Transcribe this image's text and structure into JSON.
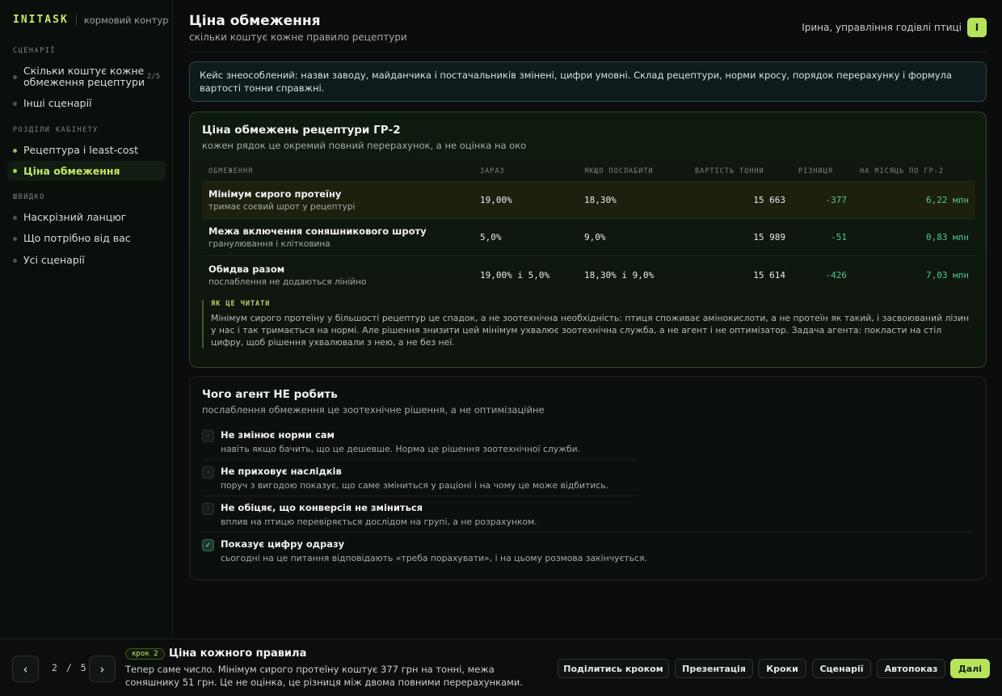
{
  "sidebar": {
    "brand": "INITASK",
    "brand_sub": "кормовий контур",
    "sections": {
      "scenarios": "СЦЕНАРІЇ",
      "cabinet": "РОЗДІЛИ КАБІНЕТУ",
      "quick": "ШВИДКО"
    },
    "scenario_items": [
      {
        "label": "Скільки коштує кожне обмеження рецептури",
        "count": "2/5"
      },
      {
        "label": "Інші сценарії"
      }
    ],
    "cabinet_items": [
      {
        "label": "Рецептура і least-cost"
      },
      {
        "label": "Ціна обмеження"
      }
    ],
    "quick_items": [
      {
        "label": "Наскрізний ланцюг"
      },
      {
        "label": "Що потрібно від вас"
      },
      {
        "label": "Усі сценарії"
      }
    ]
  },
  "header": {
    "title": "Ціна обмеження",
    "subtitle": "скільки коштує кожне правило рецептури",
    "user": "Ірина, управління годівлі птиці",
    "avatar": "І"
  },
  "notice": "Кейс знеособлений: назви заводу, майданчика і постачальників змінені, цифри умовні. Склад рецептури, норми кросу, порядок перерахунку і формула вартості тонни справжні.",
  "constraints_card": {
    "title": "Ціна обмежень рецептури ГР-2",
    "subtitle": "кожен рядок це окремий повний перерахунок, а не оцінка на око",
    "columns": [
      "ОБМЕЖЕННЯ",
      "ЗАРАЗ",
      "ЯКЩО ПОСЛАБИТИ",
      "ВАРТІСТЬ ТОННИ",
      "РІЗНИЦЯ",
      "НА МІСЯЦЬ ПО ГР-2"
    ],
    "rows": [
      {
        "name": "Мінімум сирого протеїну",
        "sub": "тримає соєвий шрот у рецептурі",
        "now": "19,00%",
        "relaxed": "18,30%",
        "cost": "15 663",
        "diff": "-377",
        "month": "6,22 млн"
      },
      {
        "name": "Межа включення соняшникового шроту",
        "sub": "гранулювання і клітковина",
        "now": "5,0%",
        "relaxed": "9,0%",
        "cost": "15 989",
        "diff": "-51",
        "month": "0,83 млн"
      },
      {
        "name": "Обидва разом",
        "sub": "послаблення не додаються лінійно",
        "now": "19,00% і 5,0%",
        "relaxed": "18,30% і 9,0%",
        "cost": "15 614",
        "diff": "-426",
        "month": "7,03 млн"
      }
    ],
    "howto_title": "ЯК ЦЕ ЧИТАТИ",
    "howto_text": "Мінімум сирого протеїну у більшості рецептур це спадок, а не зоотехнічна необхідність: птиця споживає амінокислоти, а не протеїн як такий, і засвоюваний лізин у нас і так тримається на нормі. Але рішення знизити цей мінімум ухвалює зоотехнічна служба, а не агент і не оптимізатор. Задача агента: покласти на стіл цифру, щоб рішення ухвалювали з нею, а не без неї."
  },
  "agent_card": {
    "title": "Чого агент НЕ робить",
    "subtitle": "послаблення обмеження це зоотехнічне рішення, а не оптимізаційне",
    "items": [
      {
        "mark": "·",
        "title": "Не змінює норми сам",
        "sub": "навіть якщо бачить, що це дешевше. Норма це рішення зоотехнічної служби."
      },
      {
        "mark": "·",
        "title": "Не приховує наслідків",
        "sub": "поруч з вигодою показує, що саме зміниться у раціоні і на чому це може відбитись."
      },
      {
        "mark": "·",
        "title": "Не обіцяє, що конверсія не зміниться",
        "sub": "вплив на птицю перевіряється дослідом на групі, а не розрахунком."
      },
      {
        "mark": "✓",
        "title": "Показує цифру одразу",
        "sub": "сьогодні на це питання відповідають «треба порахувати», і на цьому розмова закінчується."
      }
    ]
  },
  "bottom": {
    "prev": "‹",
    "next": "›",
    "page": "2",
    "sep": "/",
    "total": "5",
    "step_pill": "крок 2",
    "step_title": "Ціна кожного правила",
    "step_text": "Тепер саме число. Мінімум сирого протеїну коштує 377 грн на тонні, межа соняшнику 51 грн. Це не оцінка, це різниця між двома повними перерахунками.",
    "buttons": [
      "Поділитись кроком",
      "Презентація",
      "Кроки",
      "Сценарії",
      "Автопоказ",
      "Далі"
    ]
  }
}
